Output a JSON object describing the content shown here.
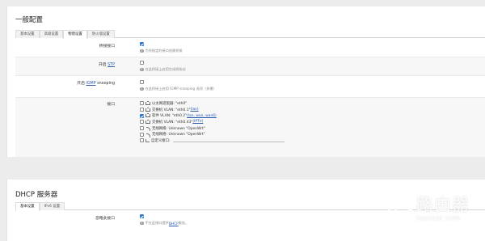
{
  "general": {
    "title": "一般配置",
    "tabs": [
      "基本设置",
      "高级设置",
      "物理设置",
      "防火墙设置"
    ],
    "active_tab": "物理设置",
    "bridge": {
      "label": "桥接接口",
      "checked": true,
      "hint": "为所指定的接口创建桥接"
    },
    "stp": {
      "label_prefix": "开启 ",
      "label_link": "STP",
      "checked": false,
      "hint": "在此桥接上启用生成树协议"
    },
    "igmp": {
      "label_prefix": "开启 ",
      "label_link": "IGMP",
      "label_suffix": " snooping",
      "checked": false,
      "hint": "在此桥接上启用 IGMP snooping 选项（多播）"
    },
    "interfaces": {
      "label": "接口",
      "items": [
        {
          "checked": false,
          "icon": "ethernet-port-icon",
          "text": "以太网适配器: \"eth0\"",
          "zones": []
        },
        {
          "checked": false,
          "icon": "ethernet-port-icon",
          "text": "交换机 VLAN: \"eth0.1\" ",
          "zones": [
            "(lan)"
          ]
        },
        {
          "checked": true,
          "icon": "ethernet-port-icon",
          "text": "软件 VLAN: \"eth0.2\" ",
          "zones": [
            "(lan, wan, wan6)"
          ]
        },
        {
          "checked": false,
          "icon": "ethernet-port-icon",
          "text": "交换机 VLAN: \"eth0.43\" ",
          "zones": [
            "(IPTV)"
          ]
        },
        {
          "checked": false,
          "icon": "wifi-icon",
          "text": "无线网络: Unknown \"OpenWrt\"",
          "zones": []
        },
        {
          "checked": false,
          "icon": "wifi-icon",
          "text": "无线网络: Unknown \"OpenWrt\"",
          "zones": []
        },
        {
          "checked": false,
          "icon": "custom-interface-icon",
          "text": "自定义接口:",
          "zones": []
        }
      ]
    }
  },
  "dhcp": {
    "title": "DHCP 服务器",
    "tabs": [
      "基本设置",
      "IPv6 设置"
    ],
    "active_tab": "基本设置",
    "ignore": {
      "label": "忽略此接口",
      "checked": true,
      "hint_prefix": "不在此接口提供 ",
      "hint_link": "DHCP",
      "hint_suffix": " 服务。"
    }
  },
  "watermark": {
    "name_cn": "路由器",
    "name_en": "luyouqi.com"
  }
}
